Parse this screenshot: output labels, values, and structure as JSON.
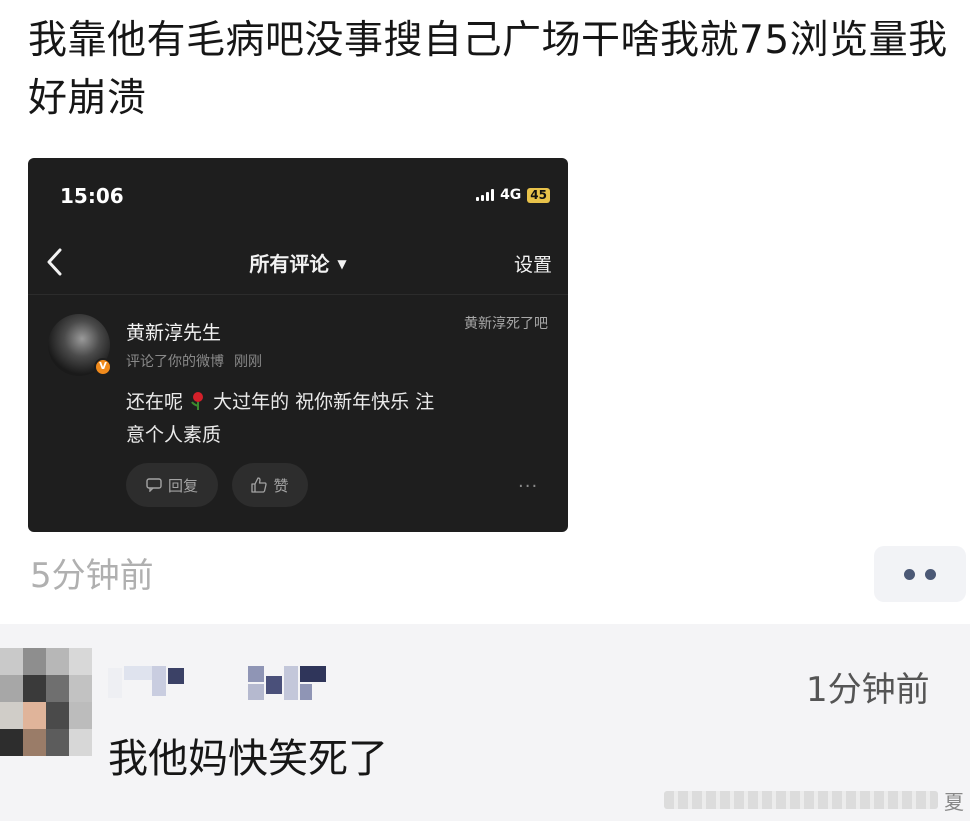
{
  "post": {
    "text": "我靠他有毛病吧没事搜自己广场干啥我就75浏览量我好崩溃",
    "time": "5分钟前",
    "more_icon": "more-dots-icon"
  },
  "screenshot": {
    "status_bar": {
      "time": "15:06",
      "network": "4G",
      "battery": "45"
    },
    "nav": {
      "title": "所有评论",
      "settings": "设置",
      "back_icon": "chevron-left-icon",
      "caret_icon": "caret-down-icon"
    },
    "comment": {
      "user": "黄新淳先生",
      "action": "评论了你的微博",
      "time": "刚刚",
      "quoted": "黄新淳死了吧",
      "body_pre": "还在呢",
      "body_post": " 大过年的 祝你新年快乐 注意个人素质",
      "emoji": "rose-icon",
      "reply_label": "回复",
      "like_label": "赞",
      "more": "···",
      "badge": "V"
    }
  },
  "reply": {
    "text": "我他妈快笑死了",
    "time": "1分钟前",
    "watermark_char": "夏"
  },
  "colors": {
    "screenshot_bg": "#1e1e1e",
    "badge": "#f08a1c",
    "battery": "#e8c24a",
    "more_dots": "#4b5875"
  }
}
